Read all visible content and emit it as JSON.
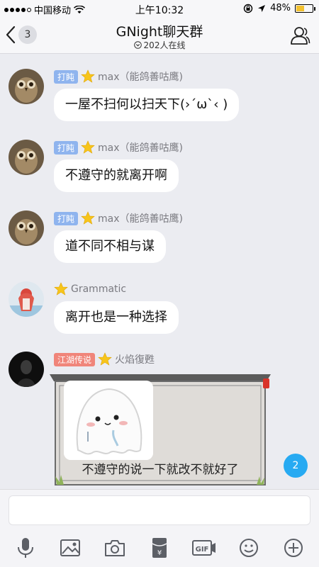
{
  "status_bar": {
    "carrier": "中国移动",
    "time": "上午10:32",
    "battery": "48%",
    "battery_level": 0.48
  },
  "header": {
    "back_count": "3",
    "title": "GNight聊天群",
    "online": "202人在线"
  },
  "messages": [
    {
      "tag": "打盹",
      "sender": "max（能鸽善咕鹰)",
      "text": "一屋不扫何以扫天下(›´ω`‹ )"
    },
    {
      "tag": "打盹",
      "sender": "max（能鸽善咕鹰)",
      "text": "不遵守的就离开啊"
    },
    {
      "tag": "打盹",
      "sender": "max（能鸽善咕鹰)",
      "text": "道不同不相与谋"
    },
    {
      "tag": "",
      "sender": "Grammatic",
      "text": "离开也是一种选择"
    },
    {
      "tag": "江湖传说",
      "sender": "火焰復甦",
      "text": "不遵守的说一下就改不就好了"
    }
  ],
  "new_messages_count": "2",
  "toolbar_icons": [
    "microphone-icon",
    "image-icon",
    "camera-icon",
    "red-packet-icon",
    "gif-icon",
    "emoji-icon",
    "plus-icon"
  ],
  "colors": {
    "accent": "#27aaf2",
    "tag_blue": "#8fb4ee",
    "tag_red": "#f0857a",
    "battery": "#f2c12e"
  }
}
